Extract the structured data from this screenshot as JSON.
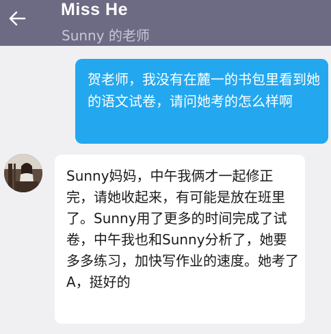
{
  "header": {
    "back_icon": "arrow-left-icon",
    "title": "Miss  He",
    "subtitle": "Sunny  的老师",
    "background": "#6d6a84"
  },
  "messages": [
    {
      "direction": "outgoing",
      "text": "贺老师，我没有在麓一的书包里看到她的语文试卷，请问她考的怎么样啊",
      "bubble_color": "#23a8f0"
    },
    {
      "direction": "incoming",
      "avatar": "avatar-photo",
      "text": "Sunny妈妈，中午我俩才一起修正完，请她收起来，有可能是放在班里了。Sunny用了更多的时间完成了试卷，中午我也和Sunny分析了，她要多多练习，加快写作业的速度。她考了A，挺好的",
      "bubble_color": "#ffffff"
    }
  ]
}
